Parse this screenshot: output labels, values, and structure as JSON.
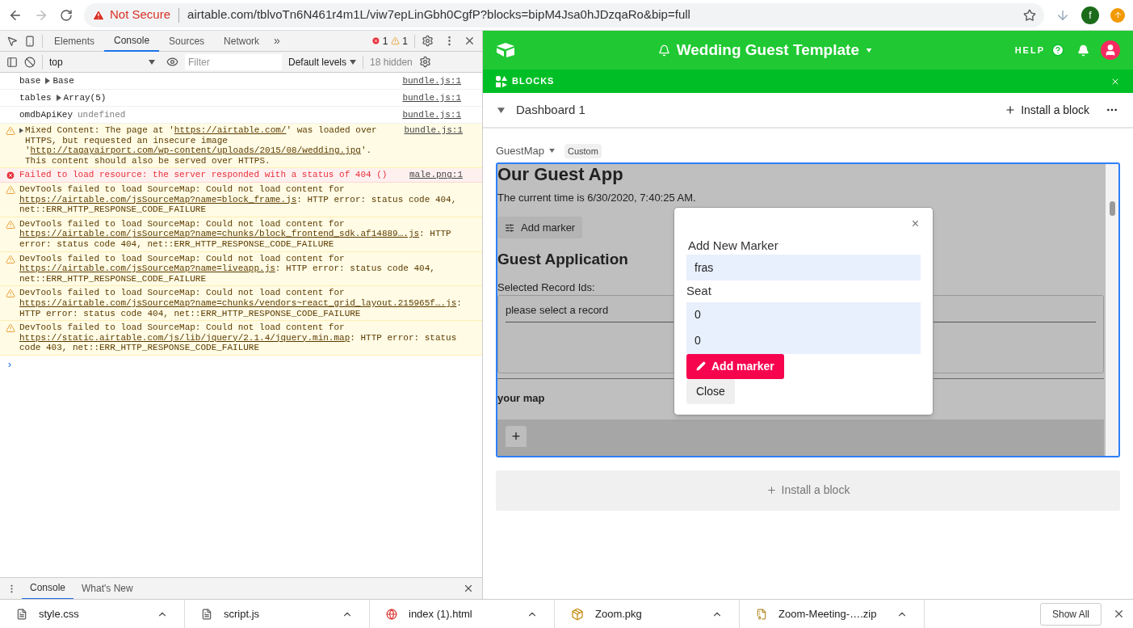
{
  "browser": {
    "security": "Not Secure",
    "url": "airtable.com/tblvoTn6N461r4m1L/viw7epLinGbh0CgfP?blocks=bipM4Jsa0hJDzqaRo&bip=full",
    "profile": "f"
  },
  "devtools": {
    "tabs": [
      {
        "label": "Elements",
        "selected": false
      },
      {
        "label": "Console",
        "selected": true
      },
      {
        "label": "Sources",
        "selected": false
      },
      {
        "label": "Network",
        "selected": false
      }
    ],
    "more": "»",
    "errors": "1",
    "warnings": "1",
    "context": "top",
    "filter": {
      "placeholder": "Filter"
    },
    "levels": "Default levels",
    "hidden": "18 hidden",
    "messages": [
      {
        "kind": "log",
        "label": "base",
        "value": "Base",
        "expandable": true,
        "source": "bundle.js:1"
      },
      {
        "kind": "log",
        "label": "tables",
        "value": "Array(5)",
        "expandable": true,
        "source": "bundle.js:1"
      },
      {
        "kind": "log",
        "label": "omdbApiKey",
        "value": "undefined",
        "expandable": false,
        "source": "bundle.js:1"
      },
      {
        "kind": "warning",
        "expandable": true,
        "source": "bundle.js:1",
        "segments": [
          {
            "text": "Mixed Content: The page at '",
            "kind": "text"
          },
          {
            "text": "https://airtable.com/",
            "kind": "link"
          },
          {
            "text": "' was loaded over HTTPS, but requested an insecure image '",
            "kind": "text"
          },
          {
            "text": "http://tagayairport.com/wp-content/uploads/",
            "kind": "link"
          },
          {
            "text": "2015/08/wedding.jpg",
            "kind": "link"
          },
          {
            "text": "'. This content should also be served over HTTPS.",
            "kind": "text"
          }
        ]
      },
      {
        "kind": "error",
        "expandable": false,
        "source": "male.png:1",
        "segments": [
          {
            "text": "Failed to load resource: the server responded with a status of 404 ()",
            "kind": "text"
          }
        ]
      },
      {
        "kind": "warning",
        "expandable": false,
        "segments": [
          {
            "text": "DevTools failed to load SourceMap: Could not load content for ",
            "kind": "text"
          },
          {
            "text": "https://airtable.com/",
            "kind": "link"
          },
          {
            "text": "jsSourceMap?name=block_frame.js",
            "kind": "link"
          },
          {
            "text": ": HTTP error: status code 404, net::ERR_HTTP_RESPONSE_CODE_FAILURE",
            "kind": "text"
          }
        ]
      },
      {
        "kind": "warning",
        "expandable": false,
        "segments": [
          {
            "text": "DevTools failed to load SourceMap: Could not load content for ",
            "kind": "text"
          },
          {
            "text": "https://airtable.com/",
            "kind": "link"
          },
          {
            "text": "jsSourceMap?name=chunks/block_frontend_sdk.af14889….js",
            "kind": "link"
          },
          {
            "text": ": HTTP error: status code 404, net::ERR_HTTP_RESPONSE_CODE_FAILURE",
            "kind": "text"
          }
        ]
      },
      {
        "kind": "warning",
        "expandable": false,
        "segments": [
          {
            "text": "DevTools failed to load SourceMap: Could not load content for ",
            "kind": "text"
          },
          {
            "text": "https://airtable.com/",
            "kind": "link"
          },
          {
            "text": "jsSourceMap?name=liveapp.js",
            "kind": "link"
          },
          {
            "text": ": HTTP error: status code 404, net::ERR_HTTP_RESPONSE_CODE_FAILURE",
            "kind": "text"
          }
        ]
      },
      {
        "kind": "warning",
        "expandable": false,
        "segments": [
          {
            "text": "DevTools failed to load SourceMap: Could not load content for ",
            "kind": "text"
          },
          {
            "text": "https://airtable.com/",
            "kind": "link"
          },
          {
            "text": "jsSourceMap?name=chunks/vendors~react_grid_layout.215965f….js",
            "kind": "link"
          },
          {
            "text": ": HTTP error: status code 404, net::ERR_HTTP_RESPONSE_CODE_FAILURE",
            "kind": "text"
          }
        ]
      },
      {
        "kind": "warning",
        "expandable": false,
        "segments": [
          {
            "text": "DevTools failed to load SourceMap: Could not load content for ",
            "kind": "text"
          },
          {
            "text": "https://static.airtab",
            "kind": "link"
          },
          {
            "text": "le.com/js/lib/jquery/2.1.4/jquery.min.map",
            "kind": "link"
          },
          {
            "text": ": HTTP error: status code 403, net::ERR_HTTP_RESPONSE_CODE_FAILURE",
            "kind": "text"
          }
        ]
      }
    ],
    "prompt": "›",
    "drawer_tabs": [
      {
        "label": "Console",
        "selected": true
      },
      {
        "label": "What's New",
        "selected": false
      }
    ]
  },
  "airtable": {
    "base_title": "Wedding Guest Template",
    "help": "HELP",
    "blocks_label": "BLOCKS",
    "dashboard": "Dashboard 1",
    "install": "Install a block",
    "block": {
      "name": "GuestMap",
      "tag": "Custom",
      "app": {
        "heading": "Our Guest App",
        "time": "The current time is 6/30/2020, 7:40:25 AM.",
        "add_marker": "Add marker",
        "subheading": "Guest Application",
        "records_label": "Selected Record Ids:",
        "records_placeholder": "please select a record",
        "map_label": "your map",
        "zoom_in": "+"
      },
      "modal": {
        "close_x": "×",
        "title": "Add New Marker",
        "name_value": "fras",
        "seat_label": "Seat",
        "seat_value": "0",
        "value_3": "0",
        "submit": "Add marker",
        "close": "Close"
      }
    },
    "install_bottom": "Install a block"
  },
  "downloads": {
    "items": [
      {
        "name": "style.css",
        "kind": "file"
      },
      {
        "name": "script.js",
        "kind": "file"
      },
      {
        "name": "index (1).html",
        "kind": "web"
      },
      {
        "name": "Zoom.pkg",
        "kind": "package"
      },
      {
        "name": "Zoom-Meeting-….zip",
        "kind": "archive"
      }
    ],
    "show_all": "Show All"
  }
}
